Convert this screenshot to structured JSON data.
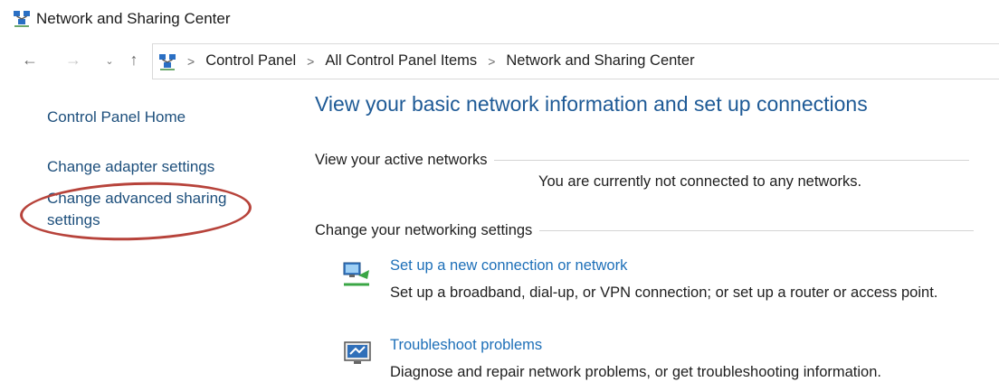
{
  "window": {
    "title": "Network and Sharing Center",
    "icon": "network-icon"
  },
  "nav": {
    "back_glyph": "←",
    "forward_glyph": "→",
    "recent_glyph": "⌄",
    "up_glyph": "↑"
  },
  "breadcrumb": {
    "separator": ">",
    "items": [
      {
        "label": "Control Panel"
      },
      {
        "label": "All Control Panel Items"
      },
      {
        "label": "Network and Sharing Center"
      }
    ]
  },
  "sidebar": {
    "items": [
      {
        "label": "Control Panel Home"
      },
      {
        "label": "Change adapter settings"
      },
      {
        "label": "Change advanced sharing settings",
        "highlighted": true
      }
    ],
    "highlight_color": "#b7433b"
  },
  "main": {
    "title": "View your basic network information and set up connections",
    "active_networks": {
      "heading": "View your active networks",
      "status": "You are currently not connected to any networks."
    },
    "change_settings": {
      "heading": "Change your networking settings",
      "tasks": [
        {
          "icon": "new-connection-icon",
          "link": "Set up a new connection or network",
          "description": "Set up a broadband, dial-up, or VPN connection; or set up a router or access point."
        },
        {
          "icon": "troubleshoot-icon",
          "link": "Troubleshoot problems",
          "description": "Diagnose and repair network problems, or get troubleshooting information."
        }
      ]
    }
  },
  "colors": {
    "link": "#1d6fb8",
    "title": "#1e5a96",
    "sidebar_link": "#1d4f7c"
  }
}
